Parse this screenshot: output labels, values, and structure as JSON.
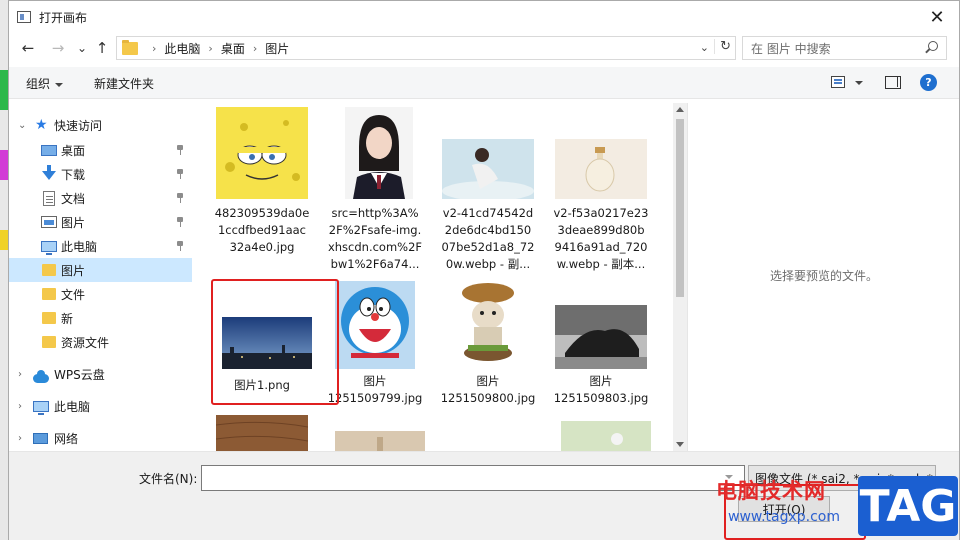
{
  "window": {
    "title": "打开画布",
    "close_glyph": "✕"
  },
  "nav": {
    "back_glyph": "←",
    "forward_glyph": "→",
    "recent_glyph": "⌄",
    "up_glyph": "↑",
    "breadcrumb": [
      "此电脑",
      "桌面",
      "图片"
    ],
    "separator": "›",
    "dropdown_glyph": "⌄",
    "refresh_glyph": "↻",
    "search_placeholder": "在 图片 中搜索"
  },
  "toolbar": {
    "organize": "组织",
    "new_folder": "新建文件夹",
    "help": "?"
  },
  "sidebar": {
    "items": [
      {
        "label": "快速访问",
        "icon": "star-icon",
        "expander": "⌄"
      },
      {
        "label": "桌面",
        "icon": "desktop-icon",
        "pinned": true
      },
      {
        "label": "下载",
        "icon": "download-icon",
        "pinned": true
      },
      {
        "label": "文档",
        "icon": "document-icon",
        "pinned": true
      },
      {
        "label": "图片",
        "icon": "pictures-icon",
        "pinned": true
      },
      {
        "label": "此电脑",
        "icon": "computer-icon",
        "pinned": true
      },
      {
        "label": "图片",
        "icon": "folder-icon",
        "selected": true
      },
      {
        "label": "文件",
        "icon": "folder-icon"
      },
      {
        "label": "新",
        "icon": "folder-icon"
      },
      {
        "label": "资源文件",
        "icon": "folder-icon"
      },
      {
        "label": "WPS云盘",
        "icon": "cloud-icon",
        "expander": "›"
      },
      {
        "label": "此电脑",
        "icon": "computer-icon",
        "expander": "›"
      },
      {
        "label": "网络",
        "icon": "network-icon",
        "expander": "›"
      }
    ]
  },
  "files": [
    {
      "name_lines": [
        "482309539da0e",
        "1ccdfbed91aac",
        "32a4e0.jpg"
      ]
    },
    {
      "name_lines": [
        "src=http%3A%",
        "2F%2Fsafe-img.",
        "xhscdn.com%2F",
        "bw1%2F6a74..."
      ]
    },
    {
      "name_lines": [
        "v2-41cd74542d",
        "2de6dc4bd150",
        "07be52d1a8_72",
        "0w.webp - 副..."
      ]
    },
    {
      "name_lines": [
        "v2-f53a0217e23",
        "3deae899d80b",
        "9416a91ad_720",
        "w.webp - 副本..."
      ]
    },
    {
      "name_lines": [
        "图片1.png"
      ]
    },
    {
      "name_lines": [
        "图片",
        "1251509799.jpg"
      ]
    },
    {
      "name_lines": [
        "图片",
        "1251509800.jpg"
      ]
    },
    {
      "name_lines": [
        "图片",
        "1251509803.jpg"
      ]
    }
  ],
  "preview": {
    "text": "选择要预览的文件。"
  },
  "bottom": {
    "filename_label": "文件名(N):",
    "filename_value": "",
    "filter": "图像文件 (*.sai2, *.sai, *.psd, *.",
    "open": "打开(O)"
  },
  "watermark": {
    "cn": "电脑技术网",
    "url": "www.tagxp.com",
    "tag": "TAG"
  },
  "colors": {
    "accent": "#1f6fcf",
    "selection": "#cce8ff",
    "highlight": "#e02020",
    "folder": "#f4c84a"
  }
}
